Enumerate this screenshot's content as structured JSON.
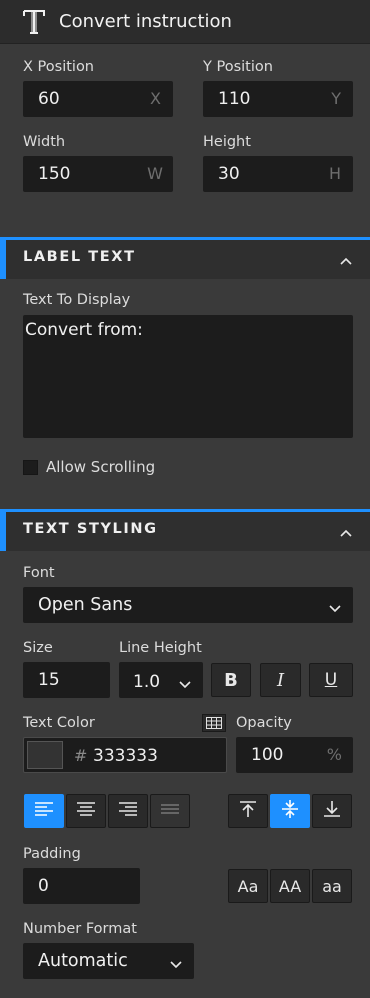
{
  "header": {
    "title": "Convert instruction"
  },
  "position": {
    "x_label": "X Position",
    "x_value": "60",
    "x_suffix": "X",
    "y_label": "Y Position",
    "y_value": "110",
    "y_suffix": "Y",
    "w_label": "Width",
    "w_value": "150",
    "w_suffix": "W",
    "h_label": "Height",
    "h_value": "30",
    "h_suffix": "H"
  },
  "label_text": {
    "section_title": "LABEL TEXT",
    "display_label": "Text To Display",
    "display_value": "Convert from:",
    "allow_scrolling_label": "Allow Scrolling",
    "allow_scrolling_checked": false
  },
  "text_styling": {
    "section_title": "TEXT STYLING",
    "font_label": "Font",
    "font_value": "Open Sans",
    "size_label": "Size",
    "size_value": "15",
    "line_height_label": "Line Height",
    "line_height_value": "1.0",
    "bold_glyph": "B",
    "italic_glyph": "I",
    "underline_glyph": "U",
    "text_color_label": "Text Color",
    "color_hash": "#",
    "color_value": "333333",
    "color_swatch": "#333333",
    "opacity_label": "Opacity",
    "opacity_value": "100",
    "opacity_suffix": "%",
    "padding_label": "Padding",
    "padding_value": "0",
    "case_options": [
      "Aa",
      "AA",
      "aa"
    ],
    "number_format_label": "Number Format",
    "number_format_value": "Automatic",
    "align_active": "left",
    "valign_active": "middle"
  },
  "colors": {
    "accent": "#1e90ff",
    "field_bg": "#1c1c1c",
    "panel_bg": "#3a3a3a"
  }
}
